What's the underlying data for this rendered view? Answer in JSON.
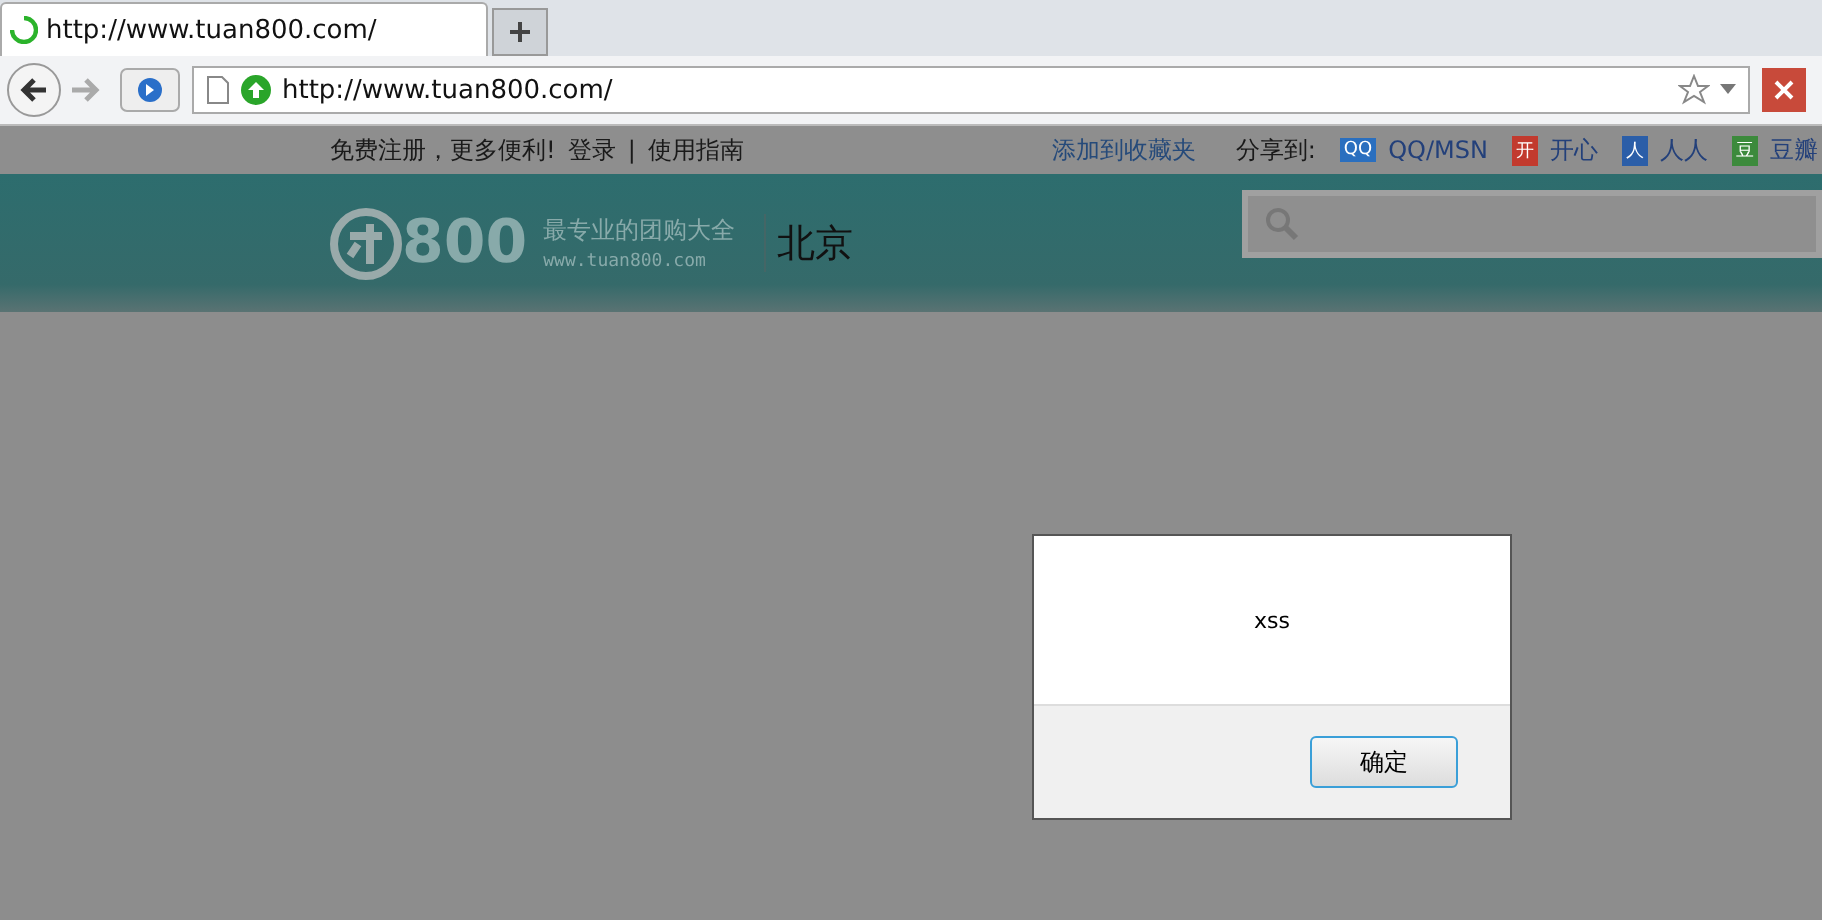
{
  "browser": {
    "tab_title": "http://www.tuan800.com/",
    "address": "http://www.tuan800.com/"
  },
  "topbar": {
    "promo": "免费注册，更多便利!",
    "login": "登录",
    "separator": "|",
    "guide": "使用指南",
    "bookmark": "添加到收藏夹",
    "share_label": "分享到:",
    "share": [
      {
        "icon": "QQ",
        "label": "QQ/MSN",
        "color": "#2a6fbf"
      },
      {
        "icon": "开",
        "label": "开心",
        "color": "#c23a2e"
      },
      {
        "icon": "人",
        "label": "人人",
        "color": "#2b5ea8"
      },
      {
        "icon": "豆",
        "label": "豆瓣",
        "color": "#3c8a3c"
      }
    ]
  },
  "header": {
    "logo": "800",
    "slogan": "最专业的团购大全",
    "site": "www.tuan800.com",
    "city": "北京"
  },
  "dialog": {
    "message": "xss",
    "button": "确定"
  }
}
